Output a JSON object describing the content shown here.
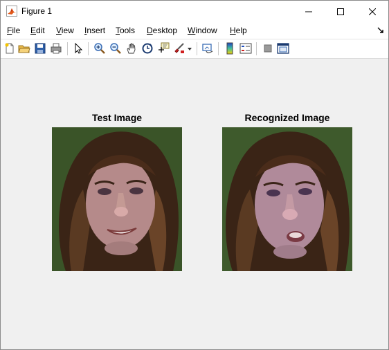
{
  "window": {
    "title": "Figure 1"
  },
  "menu": {
    "items": [
      {
        "label": "File",
        "underline": "F",
        "rest": "ile"
      },
      {
        "label": "Edit",
        "underline": "E",
        "rest": "dit"
      },
      {
        "label": "View",
        "underline": "V",
        "rest": "iew"
      },
      {
        "label": "Insert",
        "underline": "I",
        "rest": "nsert"
      },
      {
        "label": "Tools",
        "underline": "T",
        "rest": "ools"
      },
      {
        "label": "Desktop",
        "underline": "D",
        "rest": "esktop"
      },
      {
        "label": "Window",
        "underline": "W",
        "rest": "indow"
      },
      {
        "label": "Help",
        "underline": "H",
        "rest": "elp"
      }
    ]
  },
  "toolbar": {
    "icons": [
      "new-figure-icon",
      "open-file-icon",
      "save-icon",
      "print-icon",
      "pointer-icon",
      "zoom-in-icon",
      "zoom-out-icon",
      "pan-icon",
      "rotate-3d-icon",
      "data-cursor-icon",
      "brush-icon",
      "link-plot-icon",
      "colorbar-icon",
      "legend-icon",
      "hide-plot-tools-icon",
      "show-plot-tools-icon"
    ]
  },
  "axes": [
    {
      "title": "Test Image",
      "image": "face-photo-test"
    },
    {
      "title": "Recognized Image",
      "image": "face-photo-recognized"
    }
  ],
  "colors": {
    "background": "#f0f0f0",
    "photo_background": "#3e5a2c",
    "titlebar": "#ffffff"
  }
}
